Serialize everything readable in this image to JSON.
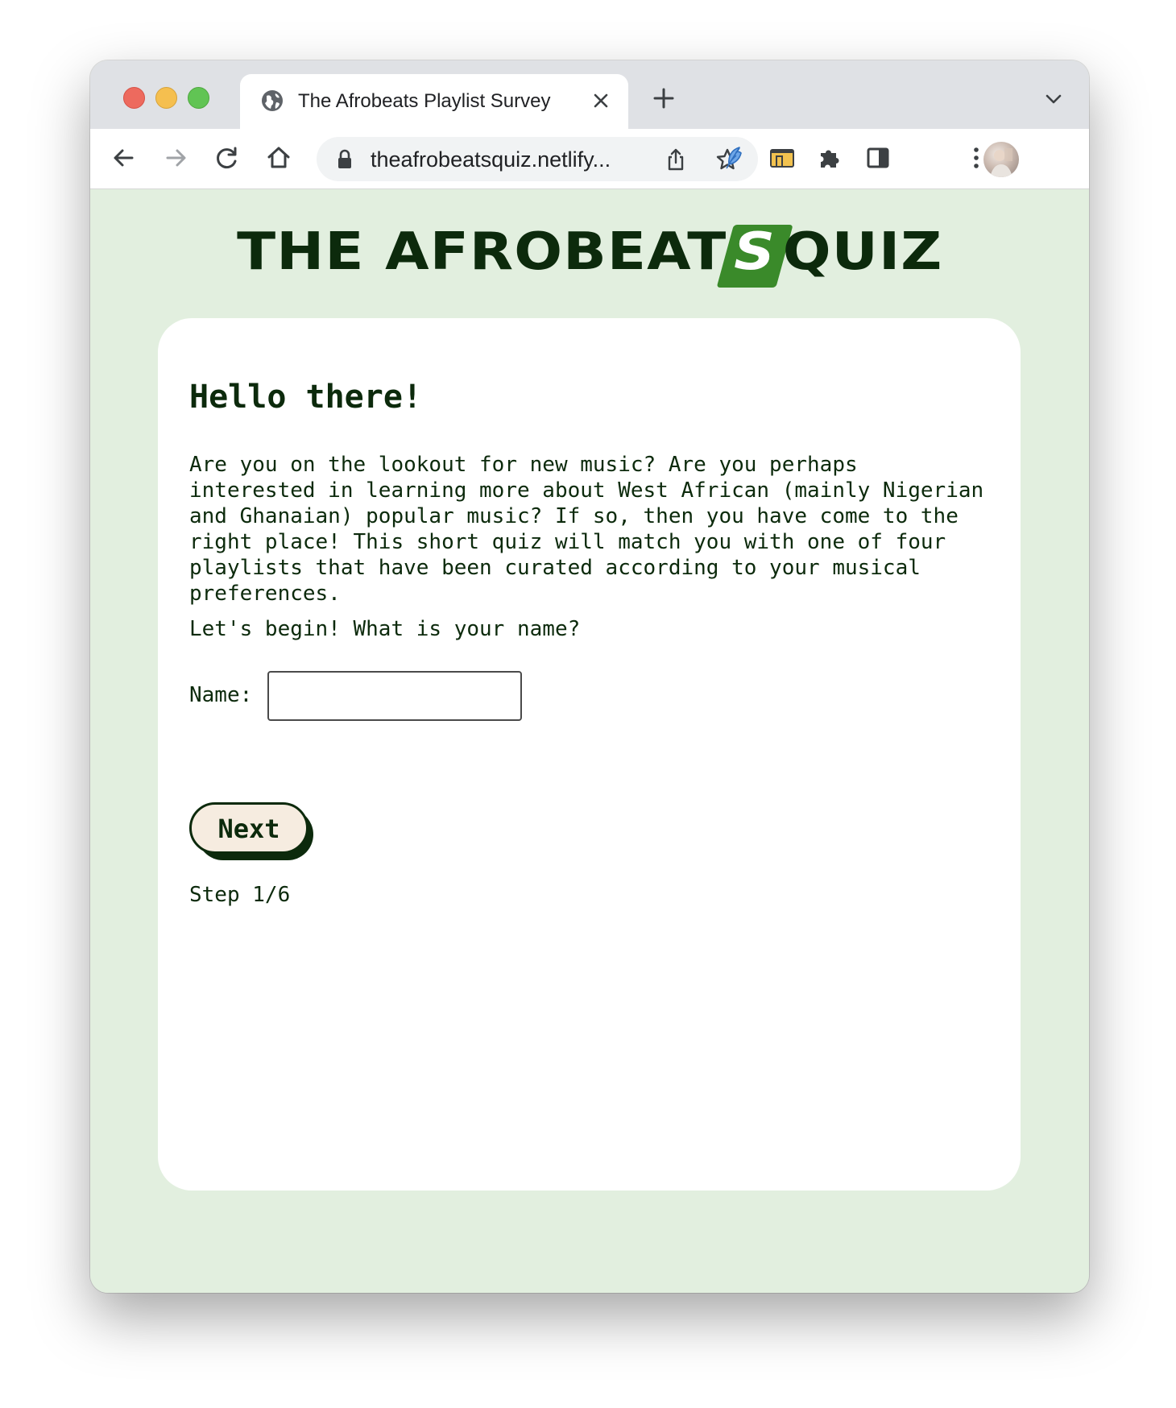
{
  "browser": {
    "tab_title": "The Afrobeats Playlist Survey",
    "url": "theafrobeatsquiz.netlify..."
  },
  "logo": {
    "before_s": "THE AFROBEAT",
    "highlight": "S",
    "after_s": "QUIZ"
  },
  "card": {
    "heading": "Hello there!",
    "intro": "Are you on the lookout for new music? Are you perhaps interested in learning more about West African (mainly Nigerian and Ghanaian) popular music? If so, then you have come to the right place! This short quiz will match you with one of four playlists that have been curated according to your musical preferences.",
    "prompt": "Let's begin! What is your name?",
    "name_label": "Name:",
    "name_value": "",
    "next_label": "Next",
    "step": "Step 1/6"
  },
  "colors": {
    "page_background": "#e2efdf",
    "text_dark_green": "#0c2a0c",
    "logo_accent": "#3a8a2a",
    "button_fill": "#f6ece0"
  },
  "icons": {
    "tab_favicon": "globe-icon",
    "tab_close": "close-icon",
    "new_tab": "plus-icon",
    "tab_search": "chevron-down-icon",
    "back": "arrow-left-icon",
    "forward": "arrow-right-icon",
    "reload": "reload-icon",
    "home": "home-icon",
    "lock": "lock-icon",
    "share": "share-icon",
    "bookmark": "star-icon",
    "extension_1": "feather-extension-icon",
    "extension_2": "folder-extension-icon",
    "extensions": "puzzle-icon",
    "side_panel": "side-panel-icon",
    "menu": "kebab-menu-icon"
  }
}
